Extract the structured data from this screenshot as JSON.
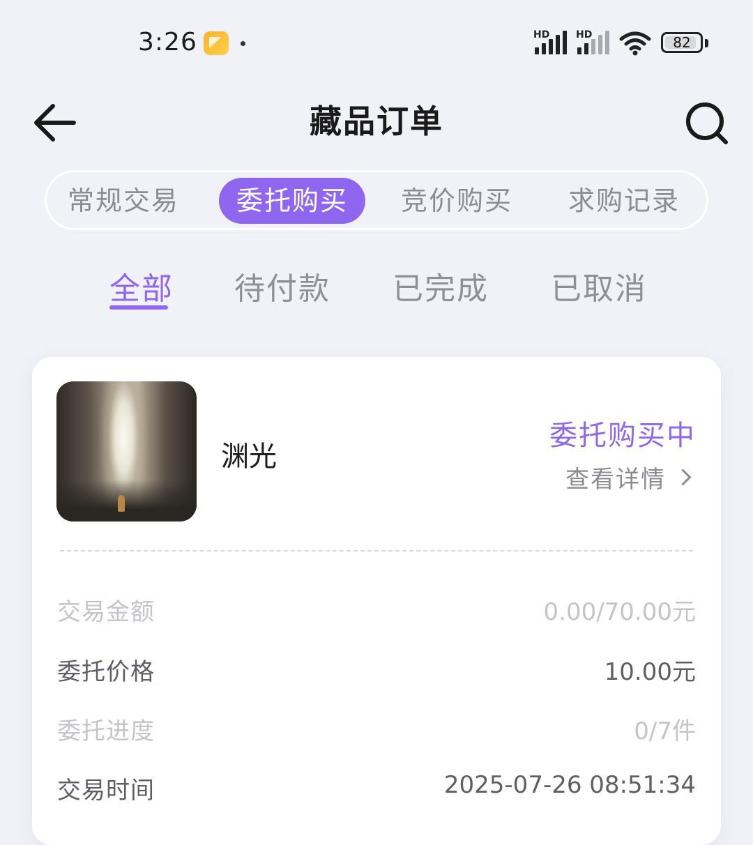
{
  "status_bar": {
    "time": "3:26",
    "signal_1_label": "HD",
    "signal_2_label": "HD",
    "battery_level": "82",
    "icons": [
      "notification-app-icon",
      "signal-icon",
      "signal-icon",
      "wifi-icon",
      "battery-icon"
    ]
  },
  "header": {
    "title": "藏品订单",
    "back_icon": "arrow-left-icon",
    "search_icon": "search-icon"
  },
  "segment_tabs": [
    {
      "label": "常规交易",
      "active": false
    },
    {
      "label": "委托购买",
      "active": true
    },
    {
      "label": "竞价购买",
      "active": false
    },
    {
      "label": "求购记录",
      "active": false
    }
  ],
  "filter_tabs": [
    {
      "label": "全部",
      "active": true
    },
    {
      "label": "待付款",
      "active": false
    },
    {
      "label": "已完成",
      "active": false
    },
    {
      "label": "已取消",
      "active": false
    }
  ],
  "order": {
    "item_name": "渊光",
    "status": "委托购买中",
    "detail_link": "查看详情",
    "rows": [
      {
        "label": "交易金额",
        "value": "0.00/70.00元"
      },
      {
        "label": "委托价格",
        "value": "10.00元"
      },
      {
        "label": "委托进度",
        "value": "0/7件"
      },
      {
        "label": "交易时间",
        "value": "2025-07-26 08:51:34"
      }
    ]
  },
  "colors": {
    "accent": "#8f66f0",
    "background": "#f1f2f7",
    "card": "#ffffff"
  }
}
